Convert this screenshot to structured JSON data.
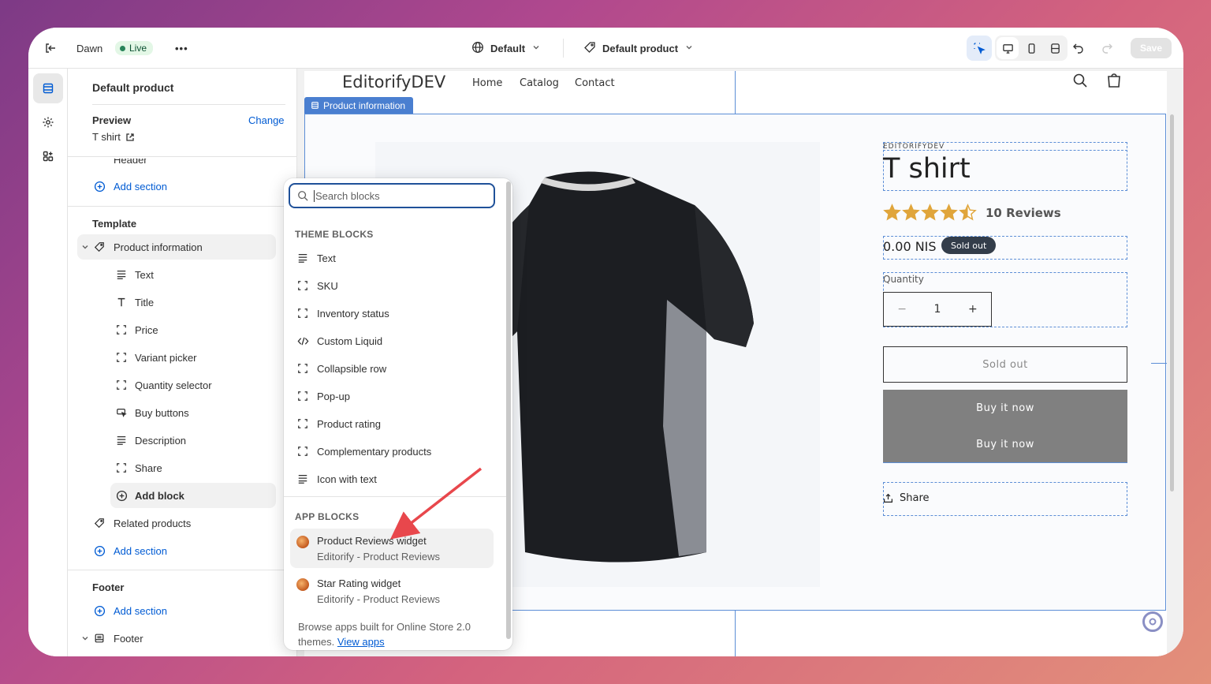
{
  "topbar": {
    "theme_name": "Dawn",
    "live_label": "Live",
    "more_label": "•••",
    "locale_label": "Default",
    "template_label": "Default product",
    "save_label": "Save"
  },
  "sidebar": {
    "title": "Default product",
    "preview_label": "Preview",
    "change_label": "Change",
    "preview_value": "T shirt",
    "header_item": "Header",
    "add_section_1": "Add section",
    "template_heading": "Template",
    "section_product_info": "Product information",
    "blocks": [
      {
        "label": "Text",
        "icon": "text-icon"
      },
      {
        "label": "Title",
        "icon": "title-icon"
      },
      {
        "label": "Price",
        "icon": "block-icon"
      },
      {
        "label": "Variant picker",
        "icon": "block-icon"
      },
      {
        "label": "Quantity selector",
        "icon": "block-icon"
      },
      {
        "label": "Buy buttons",
        "icon": "cursor-icon"
      },
      {
        "label": "Description",
        "icon": "text-icon"
      },
      {
        "label": "Share",
        "icon": "block-icon"
      }
    ],
    "add_block_label": "Add block",
    "related_products": "Related products",
    "add_section_2": "Add section",
    "footer_heading": "Footer",
    "add_section_3": "Add section",
    "footer_item": "Footer"
  },
  "popover": {
    "search_placeholder": "Search blocks",
    "theme_blocks_heading": "THEME BLOCKS",
    "theme_blocks": [
      {
        "label": "Text",
        "icon": "text-icon"
      },
      {
        "label": "SKU",
        "icon": "block-icon"
      },
      {
        "label": "Inventory status",
        "icon": "block-icon"
      },
      {
        "label": "Custom Liquid",
        "icon": "code-icon"
      },
      {
        "label": "Collapsible row",
        "icon": "block-icon"
      },
      {
        "label": "Pop-up",
        "icon": "block-icon"
      },
      {
        "label": "Product rating",
        "icon": "block-icon"
      },
      {
        "label": "Complementary products",
        "icon": "block-icon"
      },
      {
        "label": "Icon with text",
        "icon": "text-icon"
      }
    ],
    "app_blocks_heading": "APP BLOCKS",
    "app_blocks": [
      {
        "title": "Product Reviews widget",
        "subtitle": "Editorify - Product Reviews"
      },
      {
        "title": "Star Rating widget",
        "subtitle": "Editorify - Product Reviews"
      }
    ],
    "footer_text_1": "Browse apps built for Online Store 2.0",
    "footer_text_2": "themes.",
    "view_apps_label": "View apps"
  },
  "store": {
    "logo": "EditorifyDEV",
    "nav": [
      "Home",
      "Catalog",
      "Contact"
    ],
    "section_tag": "Product information",
    "vendor": "EDITORIFYDEV",
    "product_title": "T shirt",
    "rating_value": 4.5,
    "rating_max": 5,
    "reviews_label": "10 Reviews",
    "price": "0.00 NIS",
    "sold_out_badge": "Sold out",
    "quantity_label": "Quantity",
    "quantity_minus": "−",
    "quantity_value": "1",
    "quantity_plus": "+",
    "sold_out_button": "Sold out",
    "buy_now_1": "Buy it now",
    "buy_now_2": "Buy it now",
    "share_label": "Share"
  },
  "colors": {
    "accent": "#005bd3",
    "star": "#e0a53b",
    "arrow": "#e8474c"
  }
}
